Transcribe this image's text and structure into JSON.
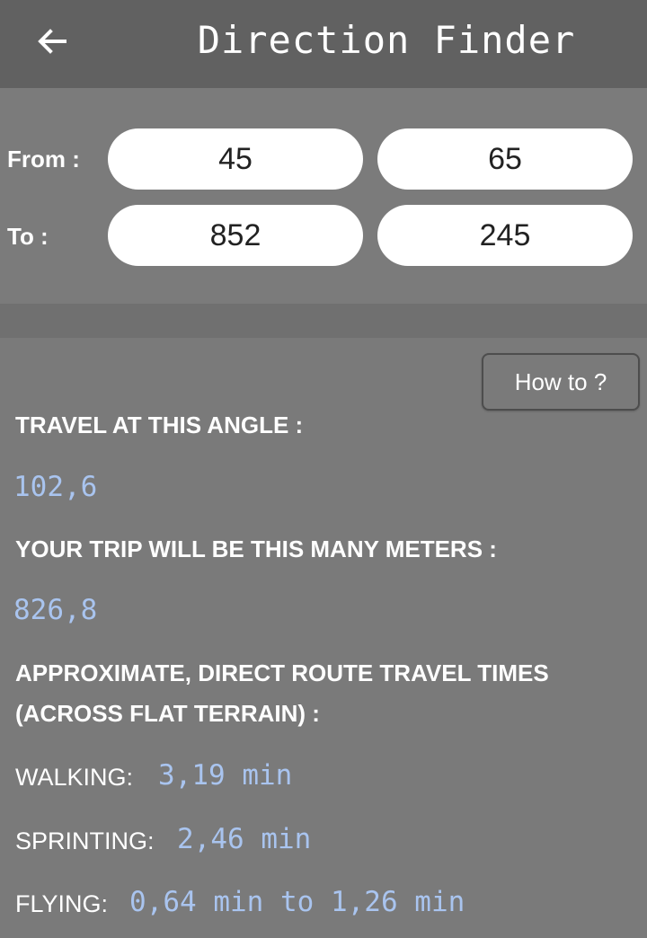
{
  "app": {
    "title": "Direction Finder",
    "back_icon": "arrow-left-icon"
  },
  "coordinates": {
    "from_label": "From :",
    "to_label": "To :",
    "from_x": "45",
    "from_y": "65",
    "to_x": "852",
    "to_y": "245"
  },
  "help": {
    "button_label": "How to ?"
  },
  "results": {
    "angle_heading": "TRAVEL AT THIS ANGLE :",
    "angle_value": "102,6",
    "distance_heading": "YOUR TRIP WILL BE THIS MANY METERS :",
    "distance_value": "826,8",
    "times_heading_line1": "APPROXIMATE, DIRECT ROUTE TRAVEL TIMES",
    "times_heading_line2": "(ACROSS FLAT TERRAIN) :",
    "walking_label": "WALKING:",
    "walking_value": "3,19 min",
    "sprinting_label": "SPRINTING:",
    "sprinting_value": "2,46 min",
    "flying_label": "FLYING:",
    "flying_value": "0,64 min to 1,26 min"
  },
  "colors": {
    "appbar": "#616161",
    "background": "#7a7a7a",
    "value_accent": "#a9c4ef"
  }
}
